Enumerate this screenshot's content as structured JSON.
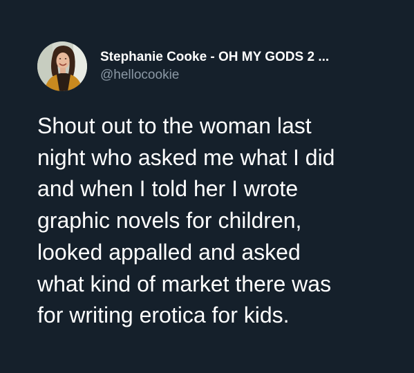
{
  "tweet": {
    "display_name": "Stephanie Cooke - OH MY GODS 2 ...",
    "handle": "@hellocookie",
    "text_lines": [
      "Shout out to the woman last",
      "night who asked me what I did",
      "and when I told her I wrote",
      "graphic novels for children,",
      "looked appalled and asked",
      "what kind of market there was",
      "for writing erotica for kids."
    ]
  },
  "colors": {
    "background": "#15202b",
    "text": "#ffffff",
    "secondary_text": "#8b98a5"
  }
}
